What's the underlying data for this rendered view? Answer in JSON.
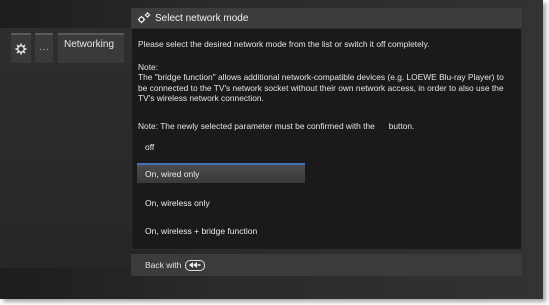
{
  "breadcrumb": {
    "dots": "···",
    "current": "Networking"
  },
  "dialog": {
    "title": "Select network mode",
    "intro": "Please select the desired network mode from the list or switch it off completely.",
    "note_heading": "Note:",
    "note_body": "The \"bridge function\" allows additional network-compatible devices (e.g. LOEWE Blu-ray Player) to be connected to the TV's network socket without their own network access, in order to also use the TV's wireless network connection.",
    "confirm_note": "Note: The newly selected parameter must be confirmed with the      button.",
    "options": [
      {
        "label": "off",
        "selected": false
      },
      {
        "label": "On, wired only",
        "selected": true
      },
      {
        "label": "On, wireless only",
        "selected": false
      },
      {
        "label": "On, wireless + bridge function",
        "selected": false
      }
    ],
    "footer_text": "Back with"
  },
  "icons": {
    "title_icon": "gears-icon",
    "breadcrumb_icon": "gear-icon",
    "back_key_icon": "back-key-icon"
  },
  "colors": {
    "selection_accent": "#3f72b0",
    "dialog_background": "#1a1a1b",
    "title_bar": "#3d3d40"
  }
}
